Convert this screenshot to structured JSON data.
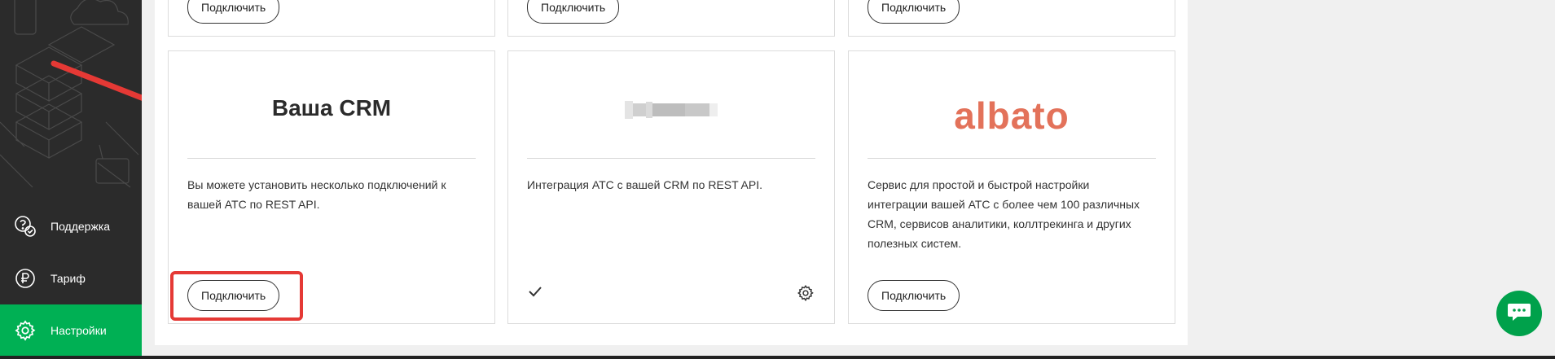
{
  "sidebar": {
    "items": [
      {
        "label": "Поддержка",
        "icon": "support-icon",
        "active": false
      },
      {
        "label": "Тариф",
        "icon": "ruble-icon",
        "active": false
      },
      {
        "label": "Настройки",
        "icon": "gear-icon",
        "active": true
      }
    ]
  },
  "top_row": {
    "cards": [
      {
        "button": "Подключить"
      },
      {
        "button": "Подключить"
      },
      {
        "button": "Подключить"
      }
    ]
  },
  "cards": [
    {
      "title": "Ваша CRM",
      "description": "Вы можете установить несколько подключений к вашей АТС по REST API.",
      "button": "Подключить"
    },
    {
      "logo": "blurred-logo",
      "description": "Интеграция АТС с вашей CRM по REST API.",
      "status_icon": "check-icon",
      "settings_icon": "gear-icon"
    },
    {
      "logo_text": "albato",
      "description": "Сервис для простой и быстрой настройки интеграции вашей АТС с более чем 100 различных CRM, сервисов аналитики, коллтрекинга и других полезных систем.",
      "button": "Подключить"
    }
  ],
  "colors": {
    "sidebar_bg": "#2b2b2b",
    "accent_green": "#00b054",
    "albato_orange": "#e3725a",
    "annotation_red": "#e53935"
  },
  "chat": {
    "icon": "chat-icon"
  }
}
